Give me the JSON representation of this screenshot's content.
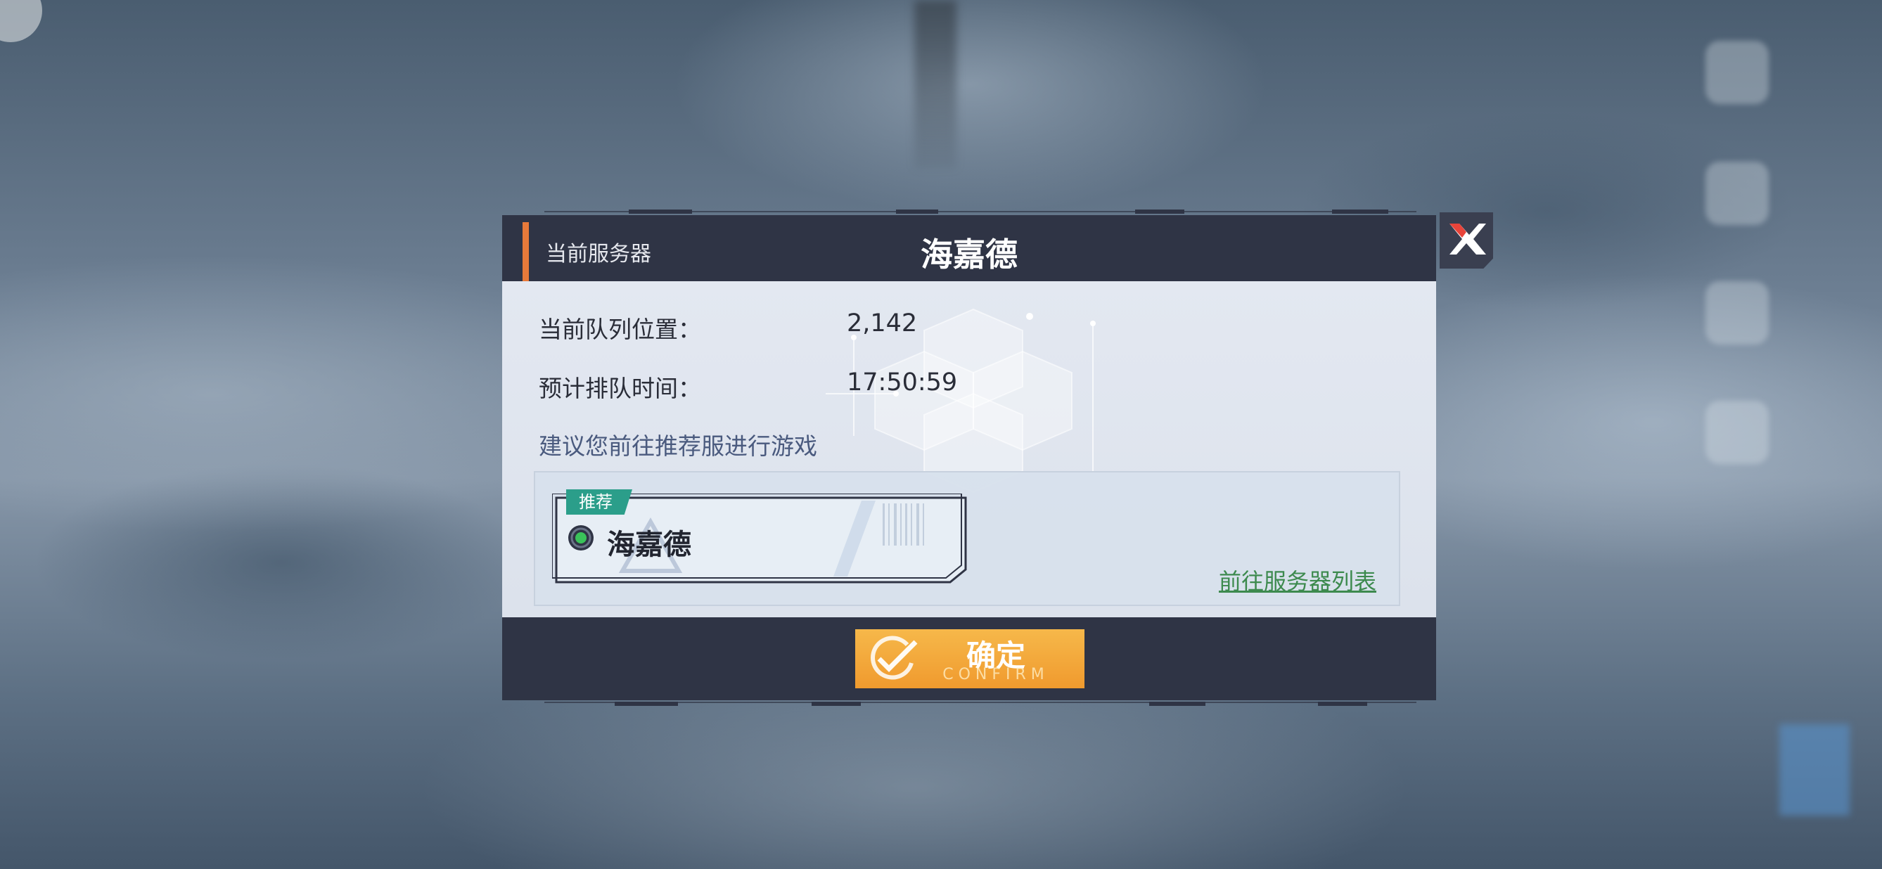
{
  "dialog": {
    "header_label": "当前服务器",
    "header_title": "海嘉德",
    "queue_position_label": "当前队列位置：",
    "queue_position_value": "2,142",
    "wait_time_label": "预计排队时间：",
    "wait_time_value": "17:50:59",
    "hint": "建议您前往推荐服进行游戏",
    "recommend_tag": "推荐",
    "recommended_server": "海嘉德",
    "server_list_link": "前往服务器列表",
    "confirm_label": "确定",
    "confirm_sub": "CONFIRM"
  },
  "icons": {
    "close": "close-x-icon",
    "status": "server-status-icon",
    "confirm": "check-icon"
  },
  "colors": {
    "header_bg": "#2f3445",
    "accent_orange": "#e87a3a",
    "tag_teal": "#2b9e8a",
    "link_green": "#3d8a4e",
    "confirm_orange": "#f09a2e",
    "status_green": "#3ac25a",
    "close_red": "#e8443a"
  }
}
